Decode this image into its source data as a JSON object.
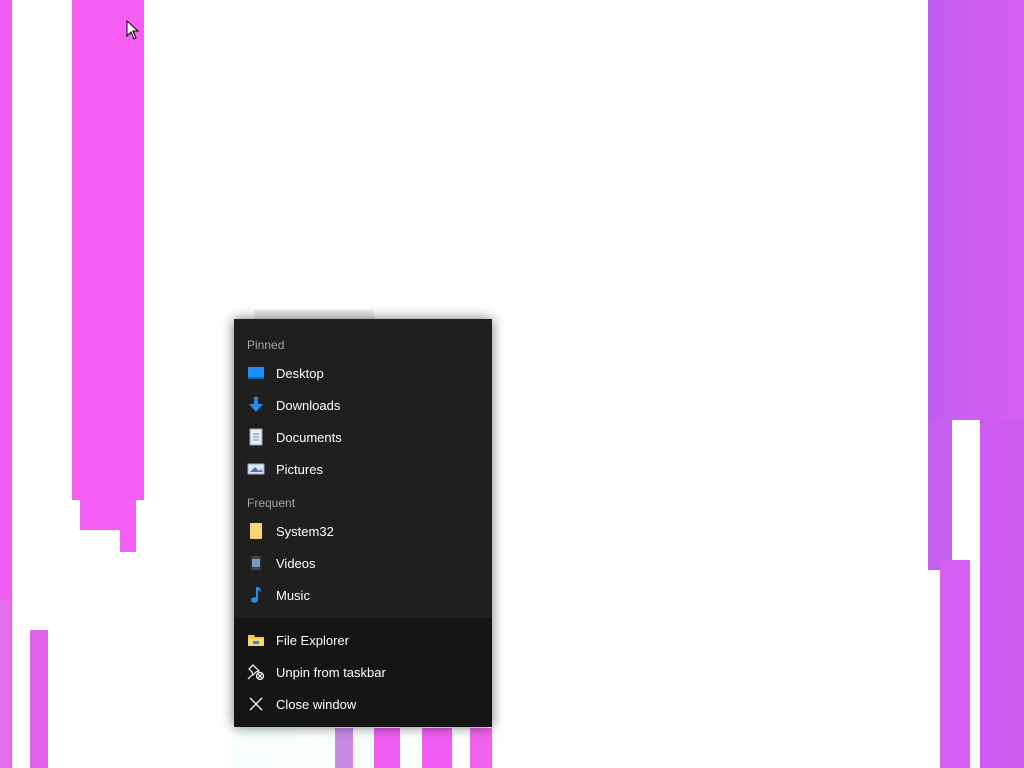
{
  "jumplist": {
    "pinned_label": "Pinned",
    "pinned": [
      {
        "label": "Desktop",
        "icon": "desktop-icon"
      },
      {
        "label": "Downloads",
        "icon": "downloads-icon"
      },
      {
        "label": "Documents",
        "icon": "documents-icon"
      },
      {
        "label": "Pictures",
        "icon": "pictures-icon"
      }
    ],
    "frequent_label": "Frequent",
    "frequent": [
      {
        "label": "System32",
        "icon": "folder-icon"
      },
      {
        "label": "Videos",
        "icon": "videos-icon"
      },
      {
        "label": "Music",
        "icon": "music-icon"
      }
    ],
    "tasks": [
      {
        "label": "File Explorer",
        "icon": "file-explorer-icon"
      },
      {
        "label": "Unpin from taskbar",
        "icon": "unpin-icon"
      },
      {
        "label": "Close window",
        "icon": "close-icon"
      }
    ]
  },
  "colors": {
    "menu_background": "#1f1f1f",
    "tasks_background": "#151515",
    "section_label": "#a6a6a6",
    "accent_blue": "#1e90ff",
    "folder_yellow": "#f8d775"
  }
}
